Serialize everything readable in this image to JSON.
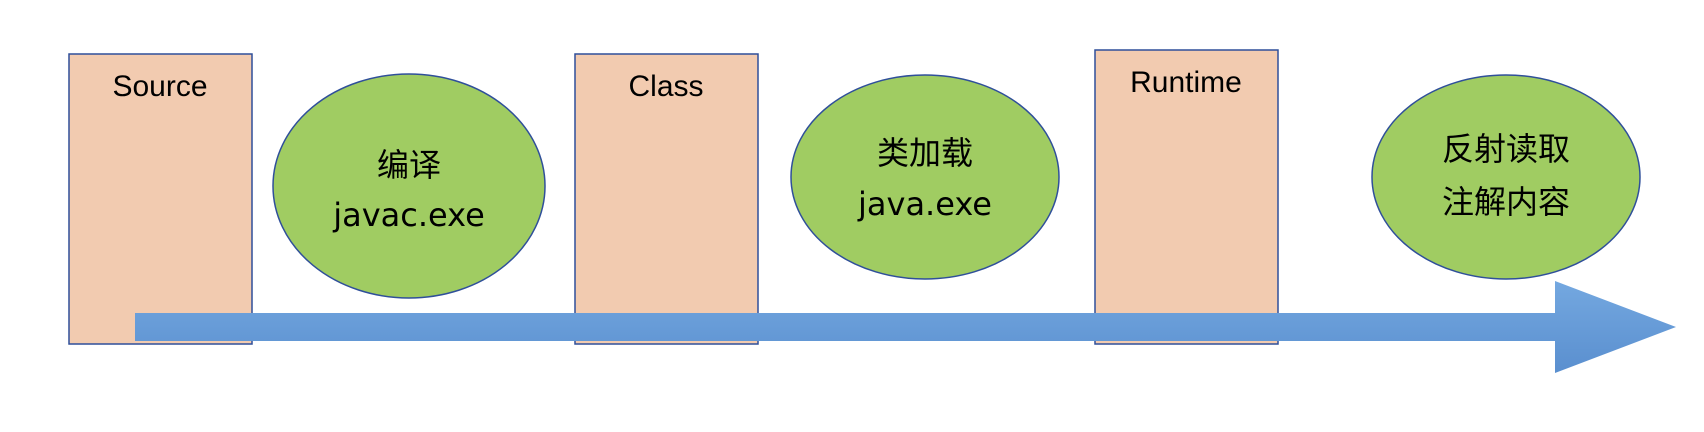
{
  "diagram": {
    "stages": [
      {
        "label": "Source"
      },
      {
        "label": "Class"
      },
      {
        "label": "Runtime"
      }
    ],
    "steps": [
      {
        "line1": "编译",
        "line2": "javac.exe"
      },
      {
        "line1": "类加载",
        "line2": "java.exe"
      },
      {
        "line1": "反射读取",
        "line2": "注解内容"
      }
    ],
    "colors": {
      "stage_fill": "#F2CBB0",
      "stage_stroke": "#2F4F9A",
      "step_fill": "#A0CC62",
      "step_stroke": "#2F4F9A",
      "arrow_fill": "#6A9FD9"
    }
  }
}
